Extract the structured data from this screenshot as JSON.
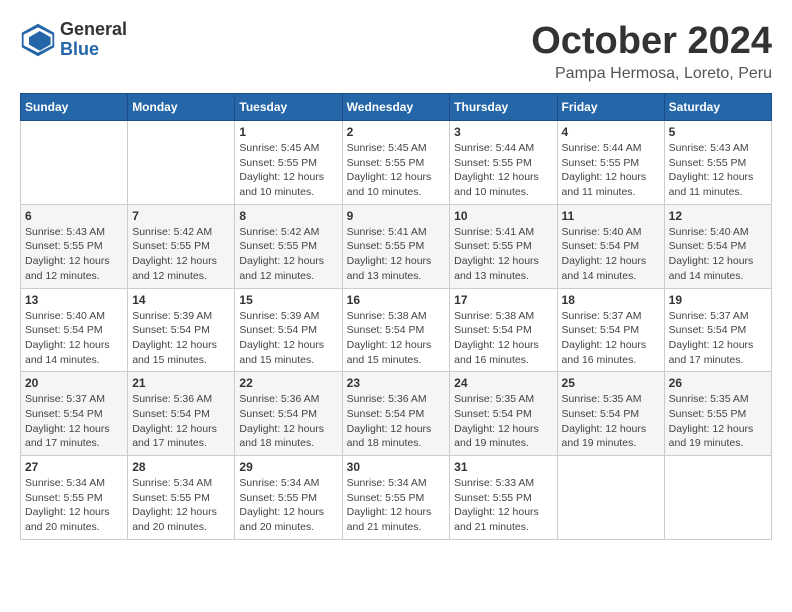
{
  "logo": {
    "general": "General",
    "blue": "Blue"
  },
  "header": {
    "month": "October 2024",
    "location": "Pampa Hermosa, Loreto, Peru"
  },
  "days_of_week": [
    "Sunday",
    "Monday",
    "Tuesday",
    "Wednesday",
    "Thursday",
    "Friday",
    "Saturday"
  ],
  "weeks": [
    [
      {
        "day": "",
        "info": ""
      },
      {
        "day": "",
        "info": ""
      },
      {
        "day": "1",
        "info": "Sunrise: 5:45 AM\nSunset: 5:55 PM\nDaylight: 12 hours\nand 10 minutes."
      },
      {
        "day": "2",
        "info": "Sunrise: 5:45 AM\nSunset: 5:55 PM\nDaylight: 12 hours\nand 10 minutes."
      },
      {
        "day": "3",
        "info": "Sunrise: 5:44 AM\nSunset: 5:55 PM\nDaylight: 12 hours\nand 10 minutes."
      },
      {
        "day": "4",
        "info": "Sunrise: 5:44 AM\nSunset: 5:55 PM\nDaylight: 12 hours\nand 11 minutes."
      },
      {
        "day": "5",
        "info": "Sunrise: 5:43 AM\nSunset: 5:55 PM\nDaylight: 12 hours\nand 11 minutes."
      }
    ],
    [
      {
        "day": "6",
        "info": "Sunrise: 5:43 AM\nSunset: 5:55 PM\nDaylight: 12 hours\nand 12 minutes."
      },
      {
        "day": "7",
        "info": "Sunrise: 5:42 AM\nSunset: 5:55 PM\nDaylight: 12 hours\nand 12 minutes."
      },
      {
        "day": "8",
        "info": "Sunrise: 5:42 AM\nSunset: 5:55 PM\nDaylight: 12 hours\nand 12 minutes."
      },
      {
        "day": "9",
        "info": "Sunrise: 5:41 AM\nSunset: 5:55 PM\nDaylight: 12 hours\nand 13 minutes."
      },
      {
        "day": "10",
        "info": "Sunrise: 5:41 AM\nSunset: 5:55 PM\nDaylight: 12 hours\nand 13 minutes."
      },
      {
        "day": "11",
        "info": "Sunrise: 5:40 AM\nSunset: 5:54 PM\nDaylight: 12 hours\nand 14 minutes."
      },
      {
        "day": "12",
        "info": "Sunrise: 5:40 AM\nSunset: 5:54 PM\nDaylight: 12 hours\nand 14 minutes."
      }
    ],
    [
      {
        "day": "13",
        "info": "Sunrise: 5:40 AM\nSunset: 5:54 PM\nDaylight: 12 hours\nand 14 minutes."
      },
      {
        "day": "14",
        "info": "Sunrise: 5:39 AM\nSunset: 5:54 PM\nDaylight: 12 hours\nand 15 minutes."
      },
      {
        "day": "15",
        "info": "Sunrise: 5:39 AM\nSunset: 5:54 PM\nDaylight: 12 hours\nand 15 minutes."
      },
      {
        "day": "16",
        "info": "Sunrise: 5:38 AM\nSunset: 5:54 PM\nDaylight: 12 hours\nand 15 minutes."
      },
      {
        "day": "17",
        "info": "Sunrise: 5:38 AM\nSunset: 5:54 PM\nDaylight: 12 hours\nand 16 minutes."
      },
      {
        "day": "18",
        "info": "Sunrise: 5:37 AM\nSunset: 5:54 PM\nDaylight: 12 hours\nand 16 minutes."
      },
      {
        "day": "19",
        "info": "Sunrise: 5:37 AM\nSunset: 5:54 PM\nDaylight: 12 hours\nand 17 minutes."
      }
    ],
    [
      {
        "day": "20",
        "info": "Sunrise: 5:37 AM\nSunset: 5:54 PM\nDaylight: 12 hours\nand 17 minutes."
      },
      {
        "day": "21",
        "info": "Sunrise: 5:36 AM\nSunset: 5:54 PM\nDaylight: 12 hours\nand 17 minutes."
      },
      {
        "day": "22",
        "info": "Sunrise: 5:36 AM\nSunset: 5:54 PM\nDaylight: 12 hours\nand 18 minutes."
      },
      {
        "day": "23",
        "info": "Sunrise: 5:36 AM\nSunset: 5:54 PM\nDaylight: 12 hours\nand 18 minutes."
      },
      {
        "day": "24",
        "info": "Sunrise: 5:35 AM\nSunset: 5:54 PM\nDaylight: 12 hours\nand 19 minutes."
      },
      {
        "day": "25",
        "info": "Sunrise: 5:35 AM\nSunset: 5:54 PM\nDaylight: 12 hours\nand 19 minutes."
      },
      {
        "day": "26",
        "info": "Sunrise: 5:35 AM\nSunset: 5:55 PM\nDaylight: 12 hours\nand 19 minutes."
      }
    ],
    [
      {
        "day": "27",
        "info": "Sunrise: 5:34 AM\nSunset: 5:55 PM\nDaylight: 12 hours\nand 20 minutes."
      },
      {
        "day": "28",
        "info": "Sunrise: 5:34 AM\nSunset: 5:55 PM\nDaylight: 12 hours\nand 20 minutes."
      },
      {
        "day": "29",
        "info": "Sunrise: 5:34 AM\nSunset: 5:55 PM\nDaylight: 12 hours\nand 20 minutes."
      },
      {
        "day": "30",
        "info": "Sunrise: 5:34 AM\nSunset: 5:55 PM\nDaylight: 12 hours\nand 21 minutes."
      },
      {
        "day": "31",
        "info": "Sunrise: 5:33 AM\nSunset: 5:55 PM\nDaylight: 12 hours\nand 21 minutes."
      },
      {
        "day": "",
        "info": ""
      },
      {
        "day": "",
        "info": ""
      }
    ]
  ]
}
